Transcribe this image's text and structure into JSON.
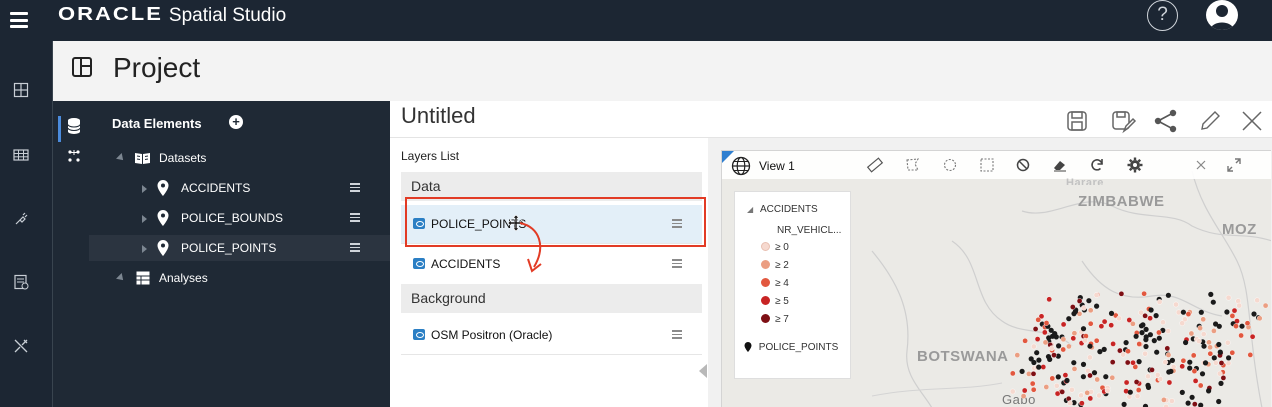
{
  "app": {
    "brand_oracle": "ORACLE",
    "brand_product": "Spatial Studio",
    "help_glyph": "?"
  },
  "header": {
    "title": "Project"
  },
  "data_elements": {
    "title": "Data Elements",
    "add_glyph": "+",
    "datasets_label": "Datasets",
    "datasets": [
      {
        "label": "ACCIDENTS"
      },
      {
        "label": "POLICE_BOUNDS"
      },
      {
        "label": "POLICE_POINTS"
      }
    ],
    "analyses_label": "Analyses"
  },
  "document": {
    "title": "Untitled"
  },
  "layers": {
    "title": "Layers List",
    "data_section": "Data",
    "data_layers": [
      {
        "label": "POLICE_POINTS"
      },
      {
        "label": "ACCIDENTS"
      }
    ],
    "background_section": "Background",
    "background_layers": [
      {
        "label": "OSM Positron (Oracle)"
      }
    ]
  },
  "map": {
    "view_name": "View 1",
    "countries": [
      "ZIMBABWE",
      "MOZ",
      "BOTSWANA",
      "Gabo"
    ],
    "partial_label": "Harare"
  },
  "legend": {
    "layer1": "ACCIDENTS",
    "field": "NR_VEHICL...",
    "classes": [
      {
        "label": "≥ 0",
        "color": "#f6d9cf"
      },
      {
        "label": "≥ 2",
        "color": "#eb9e82"
      },
      {
        "label": "≥ 4",
        "color": "#e2583f"
      },
      {
        "label": "≥ 5",
        "color": "#c82424"
      },
      {
        "label": "≥ 7",
        "color": "#7e0f14"
      }
    ],
    "layer2": "POLICE_POINTS"
  },
  "colors": {
    "topbar": "#1c2633",
    "accent": "#2f7fd0",
    "highlight_box": "#e23b25"
  }
}
